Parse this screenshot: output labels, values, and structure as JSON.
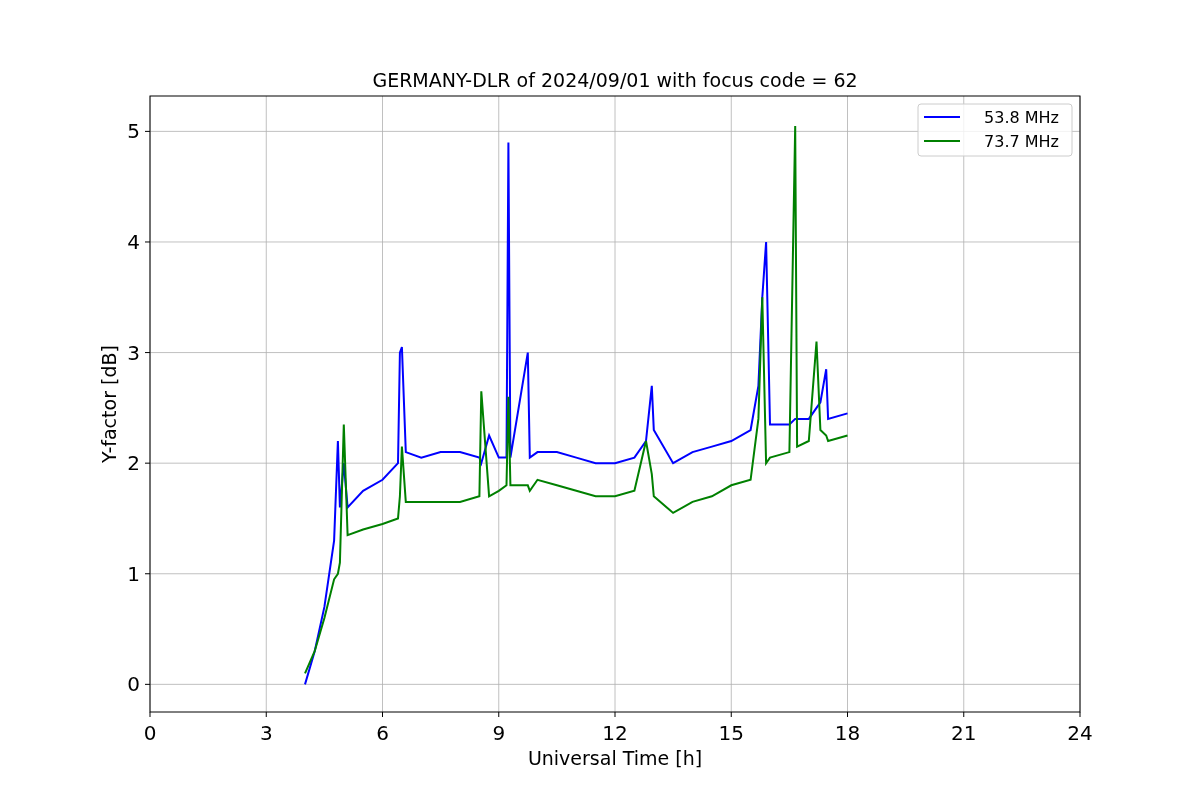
{
  "chart": {
    "chart_data": {
      "type": "line",
      "title": "GERMANY-DLR of 2024/09/01 with focus code = 62",
      "xlabel": "Universal Time [h]",
      "ylabel": "Y-factor [dB]",
      "xlim": [
        0,
        24
      ],
      "ylim": [
        -0.25,
        5.32
      ],
      "xticks": [
        0,
        3,
        6,
        9,
        12,
        15,
        18,
        21,
        24
      ],
      "yticks": [
        0,
        1,
        2,
        3,
        4,
        5
      ],
      "grid": true,
      "legend": "upper right",
      "x": [
        4,
        4.25,
        4.5,
        4.75,
        4.85,
        4.9,
        5,
        5.1,
        5.5,
        6,
        6.4,
        6.45,
        6.5,
        6.6,
        7,
        7.5,
        8,
        8.5,
        8.55,
        8.75,
        9,
        9.2,
        9.25,
        9.3,
        9.75,
        9.8,
        10,
        10.5,
        11,
        11.5,
        12,
        12.5,
        12.8,
        12.95,
        13,
        13.5,
        14,
        14.5,
        15,
        15.5,
        15.7,
        15.8,
        15.9,
        16,
        16.5,
        16.65,
        16.7,
        17,
        17.2,
        17.3,
        17.45,
        17.5,
        18
      ],
      "series": [
        {
          "name": "53.8 MHz",
          "color": "#0000ff",
          "values": [
            0.0,
            0.3,
            0.7,
            1.3,
            2.2,
            1.6,
            2.0,
            1.6,
            1.75,
            1.85,
            2.0,
            3.0,
            3.05,
            2.1,
            2.05,
            2.1,
            2.1,
            2.05,
            2.0,
            2.25,
            2.05,
            2.05,
            4.9,
            2.05,
            3.0,
            2.05,
            2.1,
            2.1,
            2.05,
            2.0,
            2.0,
            2.05,
            2.2,
            2.7,
            2.3,
            2.0,
            2.1,
            2.15,
            2.2,
            2.3,
            2.7,
            3.5,
            4.0,
            2.35,
            2.35,
            2.4,
            2.4,
            2.4,
            2.5,
            2.55,
            2.85,
            2.4,
            2.45
          ]
        },
        {
          "name": "73.7 MHz",
          "color": "#008000",
          "values": [
            0.1,
            0.3,
            0.6,
            0.95,
            1.0,
            1.1,
            2.35,
            1.35,
            1.4,
            1.45,
            1.5,
            1.7,
            2.15,
            1.65,
            1.65,
            1.65,
            1.65,
            1.7,
            2.65,
            1.7,
            1.75,
            1.8,
            2.6,
            1.8,
            1.8,
            1.75,
            1.85,
            1.8,
            1.75,
            1.7,
            1.7,
            1.75,
            2.2,
            1.9,
            1.7,
            1.55,
            1.65,
            1.7,
            1.8,
            1.85,
            2.4,
            3.5,
            2.0,
            2.05,
            2.1,
            5.05,
            2.15,
            2.2,
            3.1,
            2.3,
            2.25,
            2.2,
            2.25
          ]
        }
      ]
    }
  }
}
